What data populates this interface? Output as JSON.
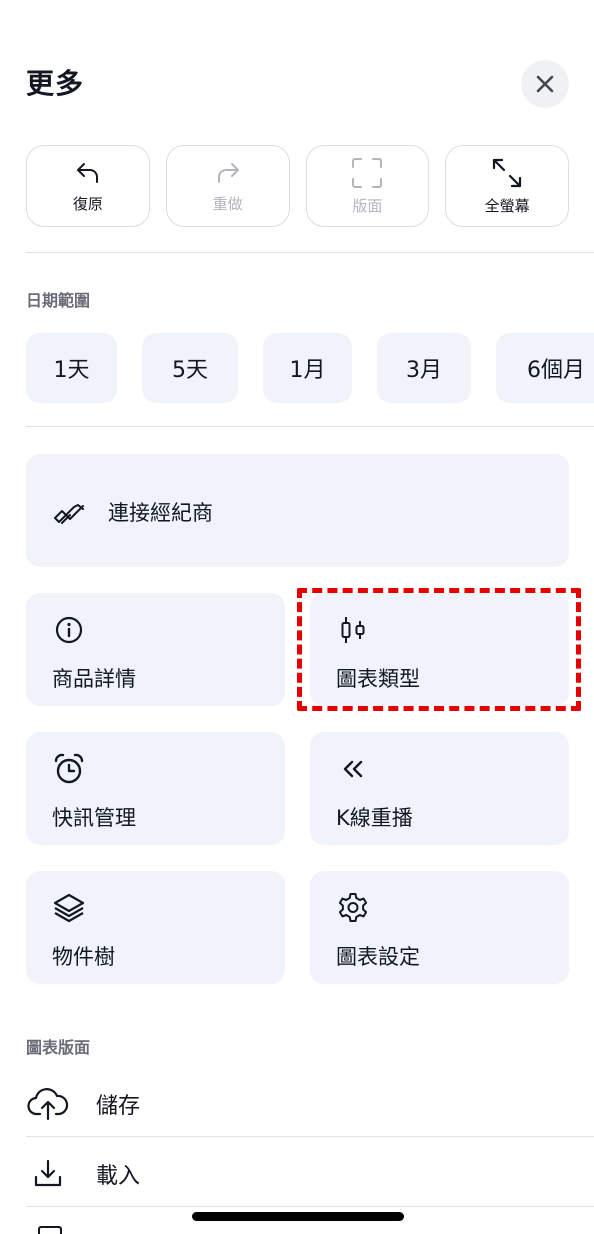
{
  "header": {
    "title": "更多"
  },
  "toolbar": [
    {
      "label": "復原",
      "icon": "undo-icon",
      "enabled": true
    },
    {
      "label": "重做",
      "icon": "redo-icon",
      "enabled": false
    },
    {
      "label": "版面",
      "icon": "layout-icon",
      "enabled": false
    },
    {
      "label": "全螢幕",
      "icon": "fullscreen-icon",
      "enabled": true
    }
  ],
  "date_range": {
    "label": "日期範圍",
    "options": [
      "1天",
      "5天",
      "1月",
      "3月",
      "6個月"
    ]
  },
  "actions": {
    "connect_broker": {
      "label": "連接經紀商",
      "icon": "handshake-icon"
    },
    "symbol_info": {
      "label": "商品詳情",
      "icon": "info-icon"
    },
    "chart_type": {
      "label": "圖表類型",
      "icon": "candlestick-icon"
    },
    "alerts": {
      "label": "快訊管理",
      "icon": "alarm-clock-icon"
    },
    "replay": {
      "label": "K線重播",
      "icon": "rewind-icon"
    },
    "object_tree": {
      "label": "物件樹",
      "icon": "layers-icon"
    },
    "chart_settings": {
      "label": "圖表設定",
      "icon": "gear-icon"
    }
  },
  "layout_section": {
    "label": "圖表版面",
    "items": [
      {
        "label": "儲存",
        "icon": "cloud-upload-icon"
      },
      {
        "label": "載入",
        "icon": "download-icon"
      }
    ]
  },
  "colors": {
    "accent_highlight": "#e60000",
    "card_bg": "#f0f3fa",
    "text": "#131722"
  }
}
